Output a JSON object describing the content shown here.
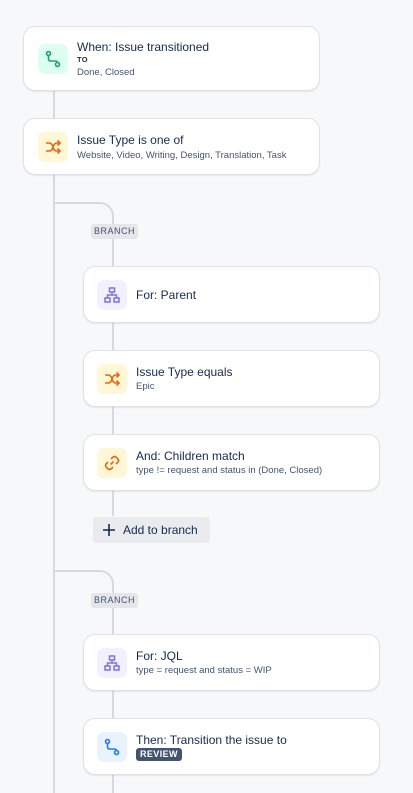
{
  "trigger": {
    "title": "When: Issue transitioned",
    "to_label": "TO",
    "statuses": "Done, Closed",
    "icon": "transition-icon",
    "color": "#22a06b"
  },
  "condition": {
    "title": "Issue Type is one of",
    "values": "Website, Video, Writing, Design, Translation, Task",
    "icon": "shuffle-icon",
    "color": "#e56910"
  },
  "branch1": {
    "label": "BRANCH",
    "for": {
      "title": "For: Parent",
      "icon": "hierarchy-icon",
      "color": "#8270db"
    },
    "issue_type": {
      "title": "Issue Type equals",
      "value": "Epic",
      "icon": "shuffle-icon",
      "color": "#e56910"
    },
    "and": {
      "title": "And: Children match",
      "value": "type != request and status in (Done, Closed)",
      "icon": "link-icon",
      "color": "#e56910"
    },
    "add_label": "Add to branch"
  },
  "branch2": {
    "label": "BRANCH",
    "for": {
      "title": "For: JQL",
      "value": "type = request and status = WIP",
      "icon": "hierarchy-icon",
      "color": "#8270db"
    },
    "then": {
      "title": "Then: Transition the issue to",
      "status": "REVIEW",
      "icon": "transition-icon",
      "color": "#1d7afc"
    }
  }
}
